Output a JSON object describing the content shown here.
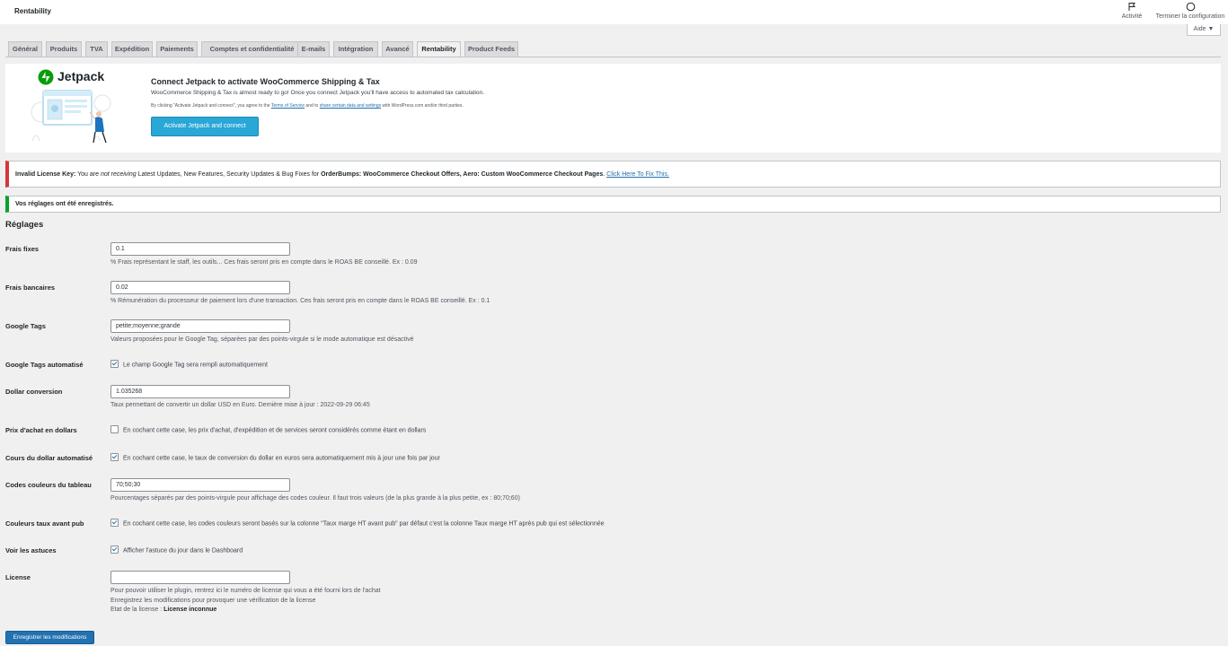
{
  "header": {
    "title": "Rentability",
    "activity_label": "Activité",
    "finish_label": "Terminer la configuration",
    "help_label": "Aide ▼"
  },
  "tabs": [
    "Général",
    "Produits",
    "TVA",
    "Expédition",
    "Paiements",
    "Comptes et confidentialité",
    "E-mails",
    "Intégration",
    "Avancé",
    "Rentability",
    "Product Feeds"
  ],
  "active_tab": "Rentability",
  "jetpack": {
    "logo_text": "Jetpack",
    "title": "Connect Jetpack to activate WooCommerce Shipping & Tax",
    "description": "WooCommerce Shipping & Tax is almost ready to go! Once you connect Jetpack you'll have access to automated tax calculation.",
    "legal_prefix": "By clicking \"Activate Jetpack and connect\", you agree to the ",
    "legal_tos": "Terms of Service",
    "legal_middle": " and to ",
    "legal_share": "share certain data and settings",
    "legal_suffix": " with WordPress.com and/or third parties.",
    "button": "Activate Jetpack and connect"
  },
  "license_notice": {
    "label": "Invalid License Key:",
    "you_are": " You are ",
    "not_receiving": "not receiving",
    "middle": " Latest Updates, New Features, Security Updates & Bug Fixes for ",
    "plugin": "OrderBumps: WooCommerce Checkout Offers, Aero: Custom WooCommerce Checkout Pages",
    "dot": ". ",
    "link": "Click Here To Fix This."
  },
  "saved_notice": "Vos réglages ont été enregistrés.",
  "section_title": "Réglages",
  "settings": {
    "frais_fixes": {
      "label": "Frais fixes",
      "value": "0.1",
      "desc": "% Frais représentant le staff, les outils... Ces frais seront pris en compte dans le ROAS BE conseillé. Ex : 0.09"
    },
    "frais_bancaires": {
      "label": "Frais bancaires",
      "value": "0.02",
      "desc": "% Rémunération du processeur de paiement lors d'une transaction. Ces frais seront pris en compte dans le ROAS BE conseillé. Ex : 0.1"
    },
    "google_tags": {
      "label": "Google Tags",
      "value": "petite;moyenne;grande",
      "desc": "Valeurs proposées pour le Google Tag, séparées par des points-virgule si le mode automatique est désactivé"
    },
    "google_tags_auto": {
      "label": "Google Tags automatisé",
      "checked": true,
      "text": "Le champ Google Tag sera rempli automatiquement"
    },
    "dollar_conversion": {
      "label": "Dollar conversion",
      "value": "1.035268",
      "desc": "Taux permettant de convertir un dollar USD en Euro. Dernière mise à jour : 2022-09-29 06:45"
    },
    "prix_achat_dollars": {
      "label": "Prix d'achat en dollars",
      "checked": false,
      "text": "En cochant cette case, les prix d'achat, d'expédition et de services seront considérés comme étant en dollars"
    },
    "cours_dollar_auto": {
      "label": "Cours du dollar automatisé",
      "checked": true,
      "text": "En cochant cette case, le taux de conversion du dollar en euros sera automatiquement mis à jour une fois par jour"
    },
    "codes_couleurs": {
      "label": "Codes couleurs du tableau",
      "value": "70;50;30",
      "desc": "Pourcentages séparés par des points-virgule pour affichage des codes couleur. Il faut trois valeurs (de la plus grande à la plus petite, ex : 80;70;60)"
    },
    "couleurs_avant_pub": {
      "label": "Couleurs taux avant pub",
      "checked": true,
      "text": "En cochant cette case, les codes couleurs seront basés sur la colonne \"Taux marge HT avant pub\" par défaut c'est la colonne Taux marge HT après pub qui est sélectionnée"
    },
    "voir_astuces": {
      "label": "Voir les astuces",
      "checked": true,
      "text": "Afficher l'astuce du jour dans le Dashboard"
    },
    "license": {
      "label": "License",
      "value": "",
      "desc1": "Pour pouvoir utiliser le plugin, rentrez ici le numéro de license qui vous a été fourni lors de l'achat",
      "desc2": "Enregistrez les modifications pour provoquer une vérification de la license",
      "status_prefix": "Etat de la license : ",
      "status": "License inconnue"
    }
  },
  "save_button": "Enregistrer les modifications",
  "colors": {
    "primary": "#2271b1",
    "jetpack_green": "#069e08",
    "jetpack_button": "#29a7d6",
    "error": "#d63638",
    "success": "#00a32a"
  }
}
